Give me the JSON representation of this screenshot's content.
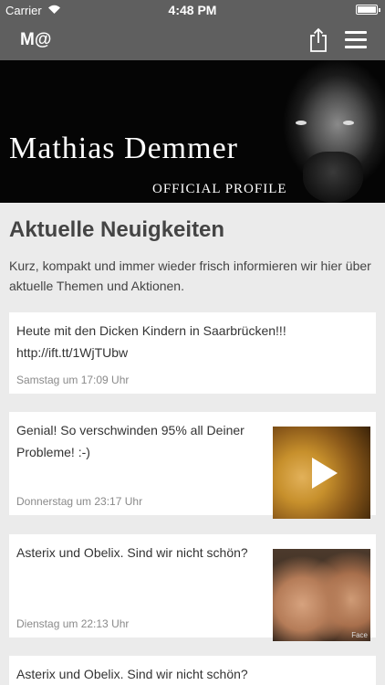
{
  "status_bar": {
    "carrier": "Carrier",
    "time": "4:48 PM"
  },
  "nav": {
    "title": "M@"
  },
  "hero": {
    "name": "Mathias Demmer",
    "subtitle": "OFFICIAL PROFILE"
  },
  "news": {
    "title": "Aktuelle Neuigkeiten",
    "intro": "Kurz, kompakt und immer wieder frisch informieren wir hier über aktuelle Themen und Aktionen.",
    "items": [
      {
        "text": "Heute mit den Dicken Kindern in Saarbrücken!!!",
        "link": "http://ift.tt/1WjTUbw",
        "date": "Samstag um 17:09 Uhr"
      },
      {
        "text": "Genial! So verschwinden 95% all Deiner",
        "text2": "Probleme! :-)",
        "date": "Donnerstag um 23:17 Uhr"
      },
      {
        "text": "Asterix und Obelix. Sind wir nicht schön?",
        "date": "Dienstag um 22:13 Uhr",
        "watermark": "Face"
      },
      {
        "text": "Asterix und Obelix. Sind wir nicht schön?"
      }
    ]
  }
}
